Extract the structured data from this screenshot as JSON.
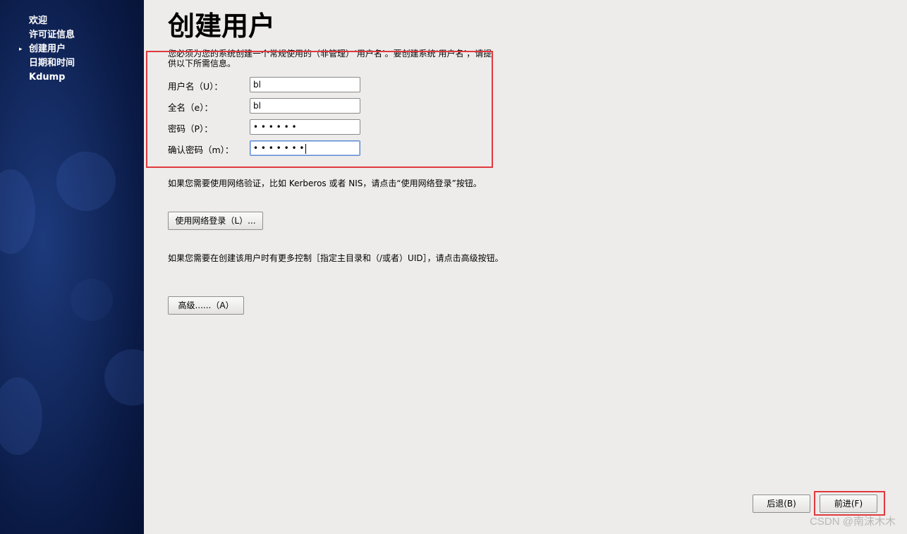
{
  "sidebar": {
    "items": [
      {
        "label": "欢迎",
        "active": false
      },
      {
        "label": "许可证信息",
        "active": false
      },
      {
        "label": "创建用户",
        "active": true
      },
      {
        "label": "日期和时间",
        "active": false
      },
      {
        "label": "Kdump",
        "active": false
      }
    ],
    "active_marker": "▸"
  },
  "page": {
    "title": "创建用户",
    "intro": "您必须为您的系统创建一个常规使用的（非管理）‘用户名’。要创建系统‘用户名’，请提供以下所需信息。"
  },
  "form": {
    "username": {
      "label": "用户名（U）：",
      "value": "bl"
    },
    "fullname": {
      "label": "全名（e）：",
      "value": "bl"
    },
    "password": {
      "label": "密码（P）：",
      "value": "• • • • • •"
    },
    "confirm": {
      "label": "确认密码（m）：",
      "value": "• • • • • • •"
    }
  },
  "network": {
    "text": "如果您需要使用网络验证，比如 Kerberos 或者 NIS，请点击“使用网络登录”按钮。",
    "button": "使用网络登录（L）..."
  },
  "advanced": {
    "text": "如果您需要在创建该用户时有更多控制［指定主目录和（/或者）UID］，请点击高级按钮。",
    "button": "高级......（A）"
  },
  "footer": {
    "back": "后退(B)",
    "forward": "前进(F)"
  },
  "watermark": "CSDN @南沫木木",
  "colors": {
    "highlight_box": "#e0393f",
    "sidebar_bg": "#0a1a45",
    "main_bg": "#edecea"
  }
}
